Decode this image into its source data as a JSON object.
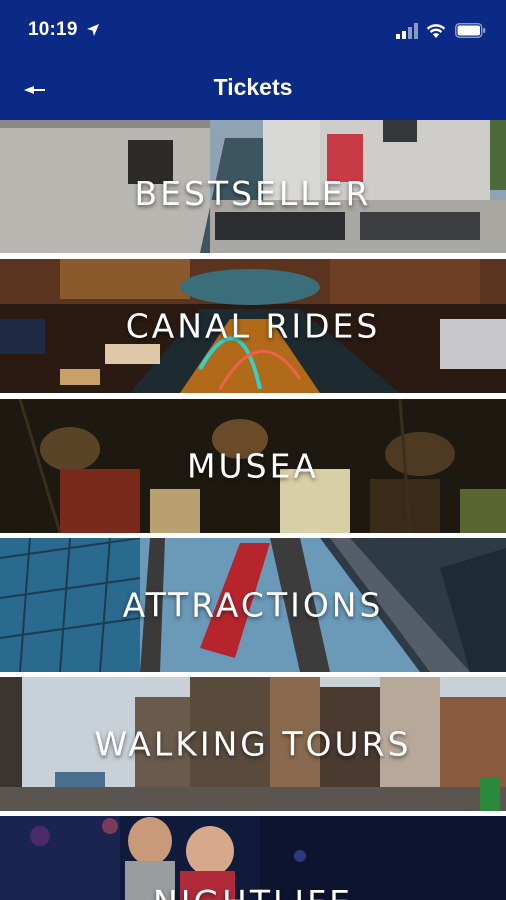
{
  "status_bar": {
    "time": "10:19",
    "icons": [
      "location-arrow-icon",
      "signal-icon",
      "wifi-icon",
      "battery-icon"
    ]
  },
  "nav": {
    "title": "Tickets",
    "back_icon": "back-arrow-icon"
  },
  "theme": {
    "header_color": "#0a2a85",
    "label_color": "#ffffff"
  },
  "categories": [
    {
      "label": "BESTSELLER"
    },
    {
      "label": "CANAL RIDES"
    },
    {
      "label": "MUSEA"
    },
    {
      "label": "ATTRACTIONS"
    },
    {
      "label": "WALKING TOURS"
    },
    {
      "label": "NIGHTLIFE"
    }
  ]
}
